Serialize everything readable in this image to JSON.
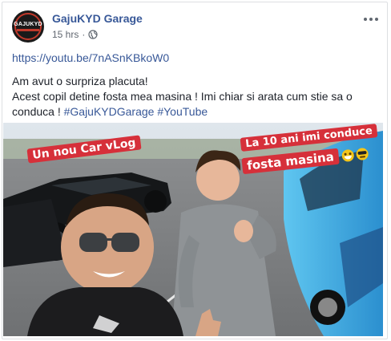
{
  "post": {
    "page_name": "GajuKYD Garage",
    "time": "15 hrs",
    "dot": "·",
    "link": "https://youtu.be/7nASnKBkoW0",
    "line1": "Am avut o surpriza placuta!",
    "line2": "Acest copil detine fosta mea masina ! Imi chiar si arata cum stie sa o",
    "line3_prefix": "conduca ! ",
    "hashtags": [
      "#GajuKYDGarage",
      "#YouTube"
    ],
    "avatar_text": "GAJUKYD"
  },
  "video": {
    "caption_left": "Un nou Car vLog",
    "caption_right_line1": "La 10 ani imi conduce",
    "caption_right_line2": "fosta masina"
  }
}
